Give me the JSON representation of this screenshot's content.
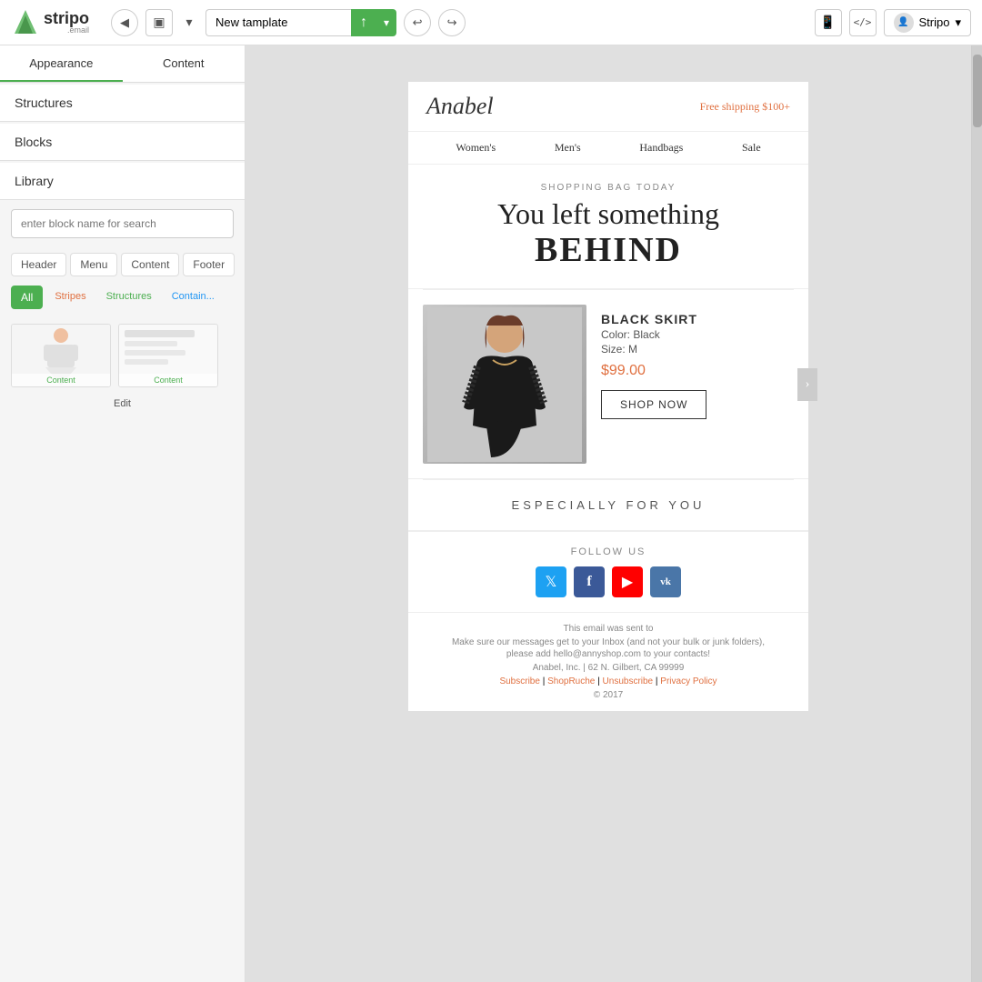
{
  "logo": {
    "text": "stripo",
    "sub": ".email"
  },
  "toolbar": {
    "back_icon": "◀",
    "template_icon": "▣",
    "dropdown_icon": "▾",
    "template_name": "New tamplate",
    "upload_icon": "↑",
    "toggle_icon": "▾",
    "undo_icon": "↩",
    "redo_icon": "↪",
    "mobile_icon": "📱",
    "code_icon": "</>",
    "user_label": "Stripo",
    "user_dropdown": "▾"
  },
  "left_panel": {
    "tabs": [
      {
        "id": "appearance",
        "label": "Appearance",
        "active": true
      },
      {
        "id": "content",
        "label": "Content",
        "active": false
      }
    ],
    "sections": [
      {
        "id": "structures",
        "label": "Structures"
      },
      {
        "id": "blocks",
        "label": "Blocks"
      },
      {
        "id": "library",
        "label": "Library"
      }
    ],
    "search_placeholder": "enter block name for search",
    "filter_tabs": [
      {
        "id": "header",
        "label": "Header"
      },
      {
        "id": "menu",
        "label": "Menu"
      },
      {
        "id": "content",
        "label": "Content"
      },
      {
        "id": "footer",
        "label": "Footer"
      }
    ],
    "category_tabs": [
      {
        "id": "all",
        "label": "All",
        "active": true
      },
      {
        "id": "stripes",
        "label": "Stripes",
        "active": false
      },
      {
        "id": "structures",
        "label": "Structures",
        "active": false
      },
      {
        "id": "contain",
        "label": "Contain...",
        "active": false
      }
    ],
    "thumbnails": [
      {
        "id": "thumb1",
        "label": "Content",
        "has_person": true
      },
      {
        "id": "thumb2",
        "label": "Content",
        "has_person": false
      }
    ],
    "edit_label": "Edit"
  },
  "email": {
    "brand": "Anabel",
    "free_shipping": "Free shipping $100+",
    "nav_items": [
      "Women's",
      "Men's",
      "Handbags",
      "Sale"
    ],
    "hero": {
      "label": "SHOPPING BAG TODAY",
      "line1": "You left something",
      "line2": "BEHIND"
    },
    "product": {
      "name": "BLACK SKIRT",
      "color": "Color: Black",
      "size": "Size: M",
      "price": "$99.00",
      "cta": "SHOP NOW"
    },
    "especially": "ESPECIALLY FOR YOU",
    "follow": {
      "title": "FOLLOW US",
      "social": [
        {
          "id": "twitter",
          "icon": "🐦"
        },
        {
          "id": "facebook",
          "icon": "f"
        },
        {
          "id": "youtube",
          "icon": "▶"
        },
        {
          "id": "vk",
          "icon": "vk"
        }
      ]
    },
    "footer": {
      "sent_to": "This email was sent to",
      "ensure": "Make sure our messages get to your Inbox (and not your bulk or junk folders),",
      "ensure2": "please add hello@annyshop.com to your contacts!",
      "address": "Anabel, Inc. | 62 N. Gilbert, CA 99999",
      "links": [
        "Subscribe",
        "ShopRuche",
        "Unsubscribe",
        "Privacy Policy"
      ],
      "link_separator": " | ",
      "copyright": "© 2017"
    }
  }
}
